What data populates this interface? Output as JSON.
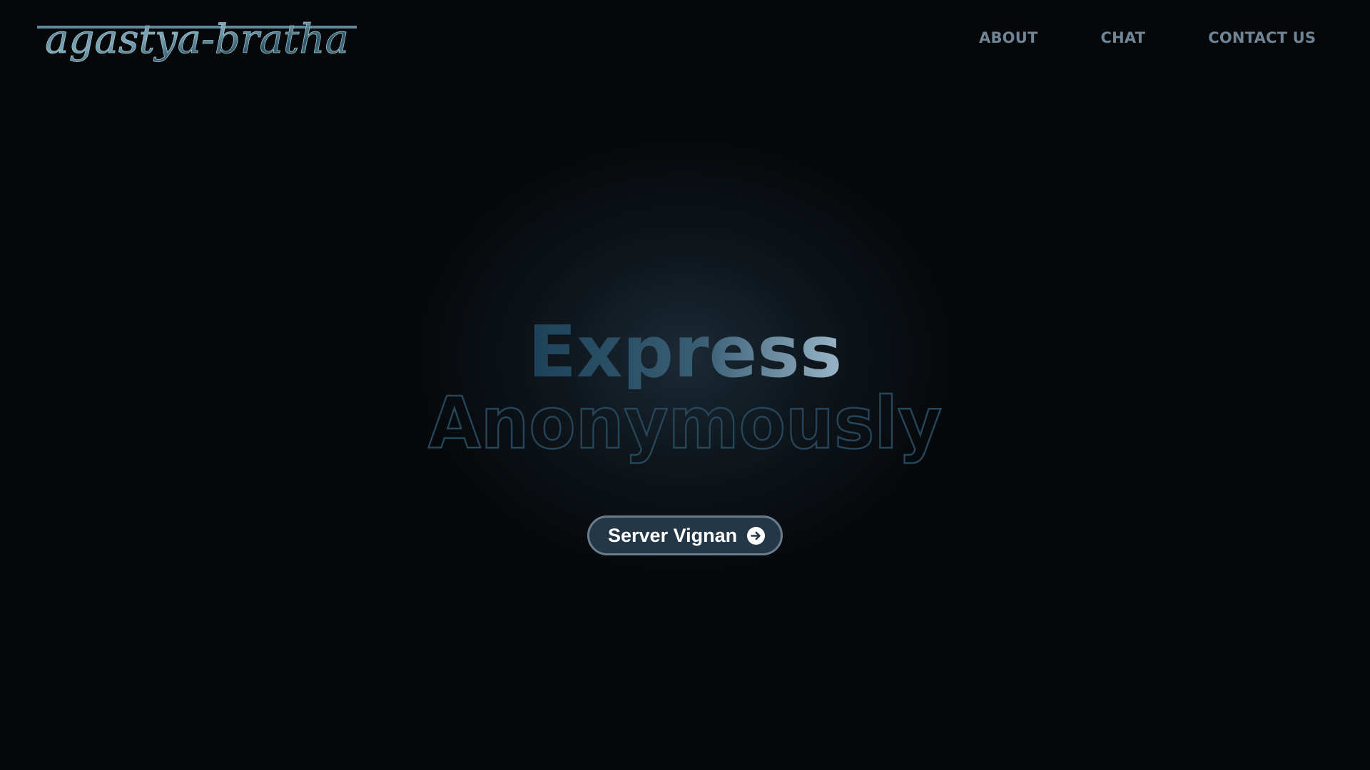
{
  "logo": {
    "text": "agastya-bratha"
  },
  "nav": {
    "items": [
      {
        "label": "ABOUT"
      },
      {
        "label": "CHAT"
      },
      {
        "label": "CONTACT US"
      }
    ]
  },
  "hero": {
    "line1": "Express",
    "line2": "Anonymously"
  },
  "cta": {
    "label": "Server Vignan",
    "icon": "arrow-right-circle-icon"
  },
  "colors": {
    "background": "#050709",
    "accent": "#1f4a63",
    "nav_text": "#6f8596",
    "button_bg": "#233746",
    "button_border": "#6a7d8c"
  }
}
